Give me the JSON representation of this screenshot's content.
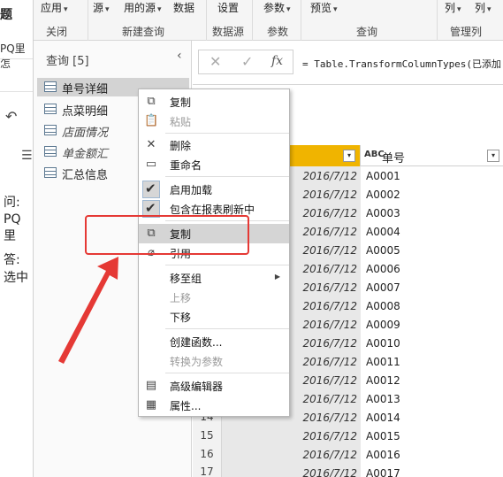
{
  "background_doc": {
    "title": "题",
    "tab": "PQ里怎",
    "q_prefix": "问:",
    "q_line2": "PQ里",
    "a_prefix": "答:",
    "a_line2": "选中"
  },
  "ribbon": {
    "buttons": {
      "apply": "应用",
      "source": "源",
      "used_sources": "用的源",
      "data": "数据",
      "settings": "设置",
      "params": "参数",
      "preview": "预览",
      "col1": "列",
      "col2": "列"
    },
    "group_labels": {
      "close": "关闭",
      "new_query": "新建查询",
      "data_source": "数据源",
      "parameters": "参数",
      "query": "查询",
      "manage_columns": "管理列"
    }
  },
  "queries_pane": {
    "title": "查询 [5]",
    "items": [
      {
        "label": "单号详细",
        "italic": false
      },
      {
        "label": "点菜明细",
        "italic": false
      },
      {
        "label": "店面情况",
        "italic": true
      },
      {
        "label": "单金额汇",
        "italic": true
      },
      {
        "label": "汇总信息",
        "italic": false
      }
    ]
  },
  "formula_bar": {
    "formula": "= Table.TransformColumnTypes(已添加"
  },
  "grid": {
    "col1_header": "期",
    "col2_header": "单号",
    "col2_type": "ABC",
    "date_value": "2016/7/12",
    "codes": [
      "A0001",
      "A0002",
      "A0003",
      "A0004",
      "A0005",
      "A0006",
      "A0007",
      "A0008",
      "A0009",
      "A0010",
      "A0011",
      "A0012",
      "A0013",
      "A0014",
      "A0015",
      "A0016",
      "A0017"
    ],
    "row_numbers": [
      "14",
      "15",
      "16",
      "17"
    ]
  },
  "context_menu": {
    "items": [
      {
        "label": "复制",
        "icon": "copy-icon",
        "enabled": true
      },
      {
        "label": "粘贴",
        "icon": "paste-icon",
        "enabled": false
      },
      {
        "label": "删除",
        "icon": "delete-icon",
        "enabled": true
      },
      {
        "label": "重命名",
        "icon": "rename-icon",
        "enabled": true
      },
      {
        "label": "启用加载",
        "icon": "check-icon",
        "enabled": true
      },
      {
        "label": "包含在报表刷新中",
        "icon": "check-icon",
        "enabled": true
      },
      {
        "label": "复制",
        "icon": "duplicate-icon",
        "enabled": true
      },
      {
        "label": "引用",
        "icon": "reference-icon",
        "enabled": true
      },
      {
        "label": "移至组",
        "icon": "",
        "enabled": true
      },
      {
        "label": "上移",
        "icon": "",
        "enabled": false
      },
      {
        "label": "下移",
        "icon": "",
        "enabled": true
      },
      {
        "label": "创建函数...",
        "icon": "",
        "enabled": true
      },
      {
        "label": "转换为参数",
        "icon": "",
        "enabled": false
      },
      {
        "label": "高级编辑器",
        "icon": "advanced-editor-icon",
        "enabled": true
      },
      {
        "label": "属性...",
        "icon": "properties-icon",
        "enabled": true
      }
    ]
  },
  "colors": {
    "accent_header": "#f0b400",
    "highlight": "#e53935",
    "menu_hover": "#d5d5d5"
  }
}
